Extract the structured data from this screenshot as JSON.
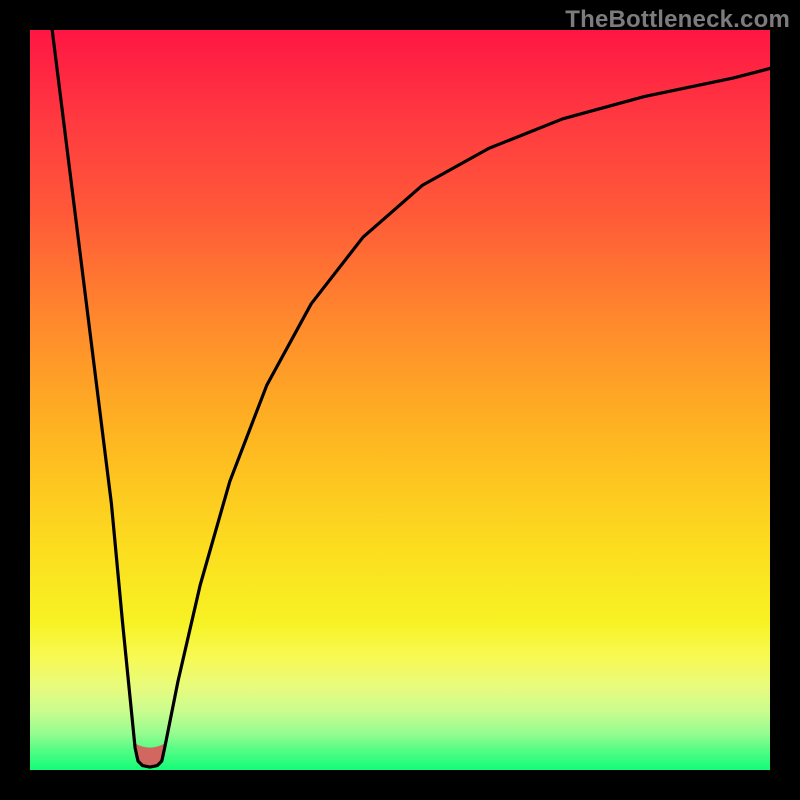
{
  "watermark": "TheBottleneck.com",
  "chart_data": {
    "type": "line",
    "title": "",
    "xlabel": "",
    "ylabel": "",
    "xlim": [
      0,
      100
    ],
    "ylim": [
      0,
      100
    ],
    "grid": false,
    "legend": false,
    "series": [
      {
        "name": "left-arm",
        "x": [
          3,
          5,
          7,
          9,
          11,
          12.5,
          13.5,
          14.2
        ],
        "values": [
          100,
          84,
          68,
          52,
          36,
          20,
          10,
          3
        ]
      },
      {
        "name": "well-bottom",
        "x": [
          14.2,
          14.6,
          15.2,
          16.2,
          17.2,
          17.8,
          18.2
        ],
        "values": [
          3,
          1.2,
          0.6,
          0.4,
          0.6,
          1.2,
          3
        ]
      },
      {
        "name": "right-arm",
        "x": [
          18.2,
          20,
          23,
          27,
          32,
          38,
          45,
          53,
          62,
          72,
          83,
          95,
          100
        ],
        "values": [
          3,
          12,
          25,
          39,
          52,
          63,
          72,
          79,
          84,
          88,
          91,
          93.5,
          94.8
        ]
      }
    ],
    "marker": {
      "name": "bottleneck-marker",
      "color": "#d1675f",
      "x_center": 16.2,
      "y_level": 1.0,
      "width_pct": 4.0
    },
    "background_gradient": {
      "top": "#ff1644",
      "bottom": "#14fc79",
      "stops": [
        "red",
        "orange",
        "yellow",
        "green"
      ]
    }
  }
}
